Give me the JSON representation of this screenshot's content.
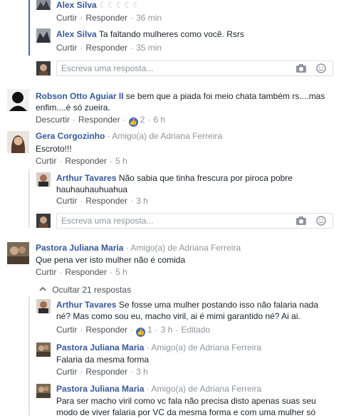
{
  "comments": {
    "alex1": {
      "name": "Alex Silva",
      "decor": "☾☾☾☾☾",
      "actions": [
        "Curtir",
        "Responder"
      ],
      "time": "36 min"
    },
    "alex2": {
      "name": "Alex Silva",
      "text": "Ta faltando mulheres como você. Rsrs",
      "actions": [
        "Curtir",
        "Responder"
      ],
      "time": "35 min"
    },
    "robson": {
      "name": "Robson Otto Aguiar II",
      "text_line1": "se bem que a piada foi meio chata também rs....mas",
      "text_line2": "enfim....é só zueira.",
      "actions": [
        "Descurtir",
        "Responder"
      ],
      "likes": "2",
      "time": "6 h"
    },
    "gera": {
      "name": "Gera Corgozinho",
      "amigo": "Amigo(a) de Adriana Ferreira",
      "text": "Escroto!!!",
      "actions": [
        "Curtir",
        "Responder"
      ],
      "time": "5 h"
    },
    "arthur1": {
      "name": "Arthur Tavares",
      "text_line1": "Não sabia que tinha frescura por piroca pobre",
      "text_line2": "hauhauhauhuahua",
      "actions": [
        "Curtir",
        "Responder"
      ],
      "time": "3 h"
    },
    "pastora1": {
      "name": "Pastora Juliana Maria",
      "amigo": "Amigo(a) de Adriana Ferreira",
      "text": "Que pena ver isto mulher não é comida",
      "actions": [
        "Curtir",
        "Responder"
      ],
      "time": "5 h"
    },
    "hide_replies": "Ocultar 21 respostas",
    "arthur2": {
      "name": "Arthur Tavares",
      "text_line1": "Se fosse uma mulher postando isso não falaria nada",
      "text_line2": "né? Mas como sou eu, macho viril, ai é mimi garantido né? Ai ai.",
      "actions": [
        "Curtir",
        "Responder"
      ],
      "likes": "1",
      "time": "3 h",
      "edited": "Editado"
    },
    "pastora2": {
      "name": "Pastora Juliana Maria",
      "amigo": "Amigo(a) de Adriana Ferreira",
      "text": "Falaria da mesma forma",
      "actions": [
        "Curtir",
        "Responder"
      ],
      "time": "3 h"
    },
    "pastora3": {
      "name": "Pastora Juliana Maria",
      "amigo": "Amigo(a) de Adriana Ferreira",
      "text_line1": "Para ser macho viril como vc fala não precisa disto apenas suas seu",
      "text_line2": "modo de viver falaria por VC da mesma forma e com uma mulher só"
    }
  },
  "reply_placeholder": "Escreva uma resposta...",
  "icons": {
    "camera": "camera-icon",
    "emoji": "emoji-icon",
    "like": "like-icon",
    "chevron": "chevron-up-icon"
  },
  "colors": {
    "name": "#365899",
    "meta": "#90949c",
    "line_active": "#4267b2",
    "line": "#dfe3ee"
  }
}
